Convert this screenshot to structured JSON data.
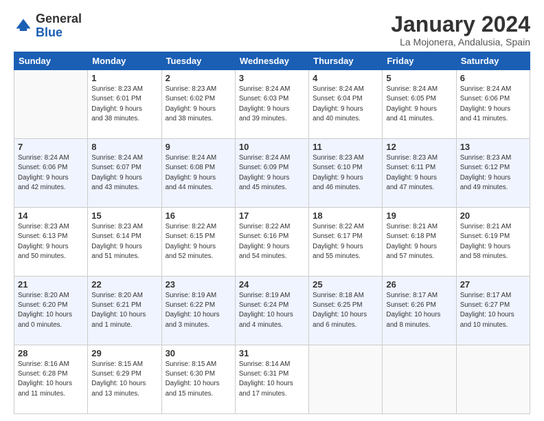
{
  "header": {
    "logo_general": "General",
    "logo_blue": "Blue",
    "month_title": "January 2024",
    "location": "La Mojonera, Andalusia, Spain"
  },
  "days_of_week": [
    "Sunday",
    "Monday",
    "Tuesday",
    "Wednesday",
    "Thursday",
    "Friday",
    "Saturday"
  ],
  "weeks": [
    [
      {
        "day": "",
        "info": ""
      },
      {
        "day": "1",
        "info": "Sunrise: 8:23 AM\nSunset: 6:01 PM\nDaylight: 9 hours\nand 38 minutes."
      },
      {
        "day": "2",
        "info": "Sunrise: 8:23 AM\nSunset: 6:02 PM\nDaylight: 9 hours\nand 38 minutes."
      },
      {
        "day": "3",
        "info": "Sunrise: 8:24 AM\nSunset: 6:03 PM\nDaylight: 9 hours\nand 39 minutes."
      },
      {
        "day": "4",
        "info": "Sunrise: 8:24 AM\nSunset: 6:04 PM\nDaylight: 9 hours\nand 40 minutes."
      },
      {
        "day": "5",
        "info": "Sunrise: 8:24 AM\nSunset: 6:05 PM\nDaylight: 9 hours\nand 41 minutes."
      },
      {
        "day": "6",
        "info": "Sunrise: 8:24 AM\nSunset: 6:06 PM\nDaylight: 9 hours\nand 41 minutes."
      }
    ],
    [
      {
        "day": "7",
        "info": "Sunrise: 8:24 AM\nSunset: 6:06 PM\nDaylight: 9 hours\nand 42 minutes."
      },
      {
        "day": "8",
        "info": "Sunrise: 8:24 AM\nSunset: 6:07 PM\nDaylight: 9 hours\nand 43 minutes."
      },
      {
        "day": "9",
        "info": "Sunrise: 8:24 AM\nSunset: 6:08 PM\nDaylight: 9 hours\nand 44 minutes."
      },
      {
        "day": "10",
        "info": "Sunrise: 8:24 AM\nSunset: 6:09 PM\nDaylight: 9 hours\nand 45 minutes."
      },
      {
        "day": "11",
        "info": "Sunrise: 8:23 AM\nSunset: 6:10 PM\nDaylight: 9 hours\nand 46 minutes."
      },
      {
        "day": "12",
        "info": "Sunrise: 8:23 AM\nSunset: 6:11 PM\nDaylight: 9 hours\nand 47 minutes."
      },
      {
        "day": "13",
        "info": "Sunrise: 8:23 AM\nSunset: 6:12 PM\nDaylight: 9 hours\nand 49 minutes."
      }
    ],
    [
      {
        "day": "14",
        "info": "Sunrise: 8:23 AM\nSunset: 6:13 PM\nDaylight: 9 hours\nand 50 minutes."
      },
      {
        "day": "15",
        "info": "Sunrise: 8:23 AM\nSunset: 6:14 PM\nDaylight: 9 hours\nand 51 minutes."
      },
      {
        "day": "16",
        "info": "Sunrise: 8:22 AM\nSunset: 6:15 PM\nDaylight: 9 hours\nand 52 minutes."
      },
      {
        "day": "17",
        "info": "Sunrise: 8:22 AM\nSunset: 6:16 PM\nDaylight: 9 hours\nand 54 minutes."
      },
      {
        "day": "18",
        "info": "Sunrise: 8:22 AM\nSunset: 6:17 PM\nDaylight: 9 hours\nand 55 minutes."
      },
      {
        "day": "19",
        "info": "Sunrise: 8:21 AM\nSunset: 6:18 PM\nDaylight: 9 hours\nand 57 minutes."
      },
      {
        "day": "20",
        "info": "Sunrise: 8:21 AM\nSunset: 6:19 PM\nDaylight: 9 hours\nand 58 minutes."
      }
    ],
    [
      {
        "day": "21",
        "info": "Sunrise: 8:20 AM\nSunset: 6:20 PM\nDaylight: 10 hours\nand 0 minutes."
      },
      {
        "day": "22",
        "info": "Sunrise: 8:20 AM\nSunset: 6:21 PM\nDaylight: 10 hours\nand 1 minute."
      },
      {
        "day": "23",
        "info": "Sunrise: 8:19 AM\nSunset: 6:22 PM\nDaylight: 10 hours\nand 3 minutes."
      },
      {
        "day": "24",
        "info": "Sunrise: 8:19 AM\nSunset: 6:24 PM\nDaylight: 10 hours\nand 4 minutes."
      },
      {
        "day": "25",
        "info": "Sunrise: 8:18 AM\nSunset: 6:25 PM\nDaylight: 10 hours\nand 6 minutes."
      },
      {
        "day": "26",
        "info": "Sunrise: 8:17 AM\nSunset: 6:26 PM\nDaylight: 10 hours\nand 8 minutes."
      },
      {
        "day": "27",
        "info": "Sunrise: 8:17 AM\nSunset: 6:27 PM\nDaylight: 10 hours\nand 10 minutes."
      }
    ],
    [
      {
        "day": "28",
        "info": "Sunrise: 8:16 AM\nSunset: 6:28 PM\nDaylight: 10 hours\nand 11 minutes."
      },
      {
        "day": "29",
        "info": "Sunrise: 8:15 AM\nSunset: 6:29 PM\nDaylight: 10 hours\nand 13 minutes."
      },
      {
        "day": "30",
        "info": "Sunrise: 8:15 AM\nSunset: 6:30 PM\nDaylight: 10 hours\nand 15 minutes."
      },
      {
        "day": "31",
        "info": "Sunrise: 8:14 AM\nSunset: 6:31 PM\nDaylight: 10 hours\nand 17 minutes."
      },
      {
        "day": "",
        "info": ""
      },
      {
        "day": "",
        "info": ""
      },
      {
        "day": "",
        "info": ""
      }
    ]
  ]
}
